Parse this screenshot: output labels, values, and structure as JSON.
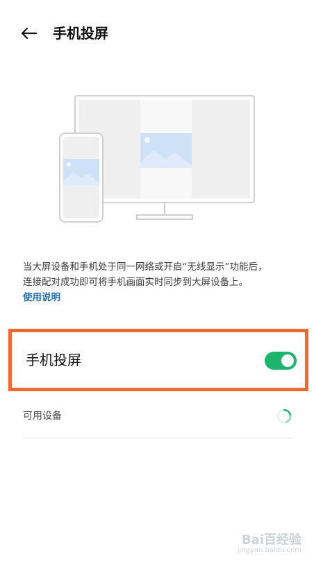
{
  "header": {
    "title": "手机投屏"
  },
  "description": {
    "line1": "当大屏设备和手机处于同一网络或开启“无线显示”功能后，",
    "line2": "连接配对成功即可将手机画面实时同步到大屏设备上。",
    "help_link": "使用说明"
  },
  "cast_setting": {
    "label": "手机投屏",
    "enabled": true
  },
  "devices": {
    "label": "可用设备",
    "status_icon": "loading-spinner"
  },
  "watermark": {
    "brand": "Bai百经验",
    "sub": "jingyan.baidu.com"
  },
  "colors": {
    "accent_green": "#1db46d",
    "highlight_orange": "#ef6a2c",
    "link_blue": "#1f6fb8"
  },
  "icons": {
    "back": "back-arrow-icon",
    "illustration": "tv-phone-illustration"
  }
}
